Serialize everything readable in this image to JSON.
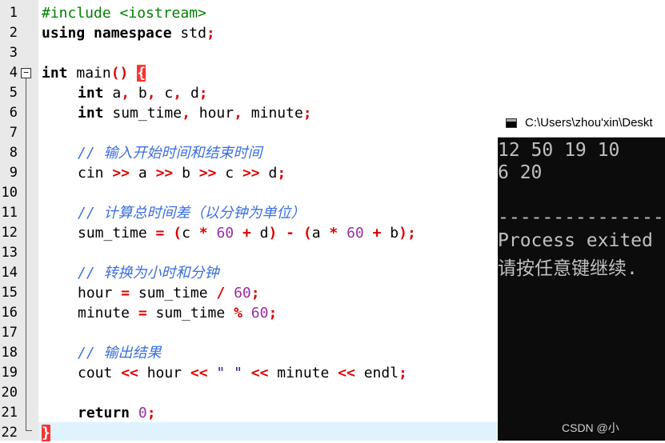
{
  "editor": {
    "line_numbers": [
      "1",
      "2",
      "3",
      "4",
      "5",
      "6",
      "7",
      "8",
      "9",
      "10",
      "11",
      "12",
      "13",
      "14",
      "15",
      "16",
      "17",
      "18",
      "19",
      "20",
      "21",
      "22"
    ],
    "fold_marker": "−",
    "lines": {
      "l1_pre": "#include <iostream>",
      "l2_kw": "using namespace",
      "l2_txt": " std",
      "l2_semi": ";",
      "l4_kw": "int",
      "l4_txt": " main",
      "l4_paren": "()",
      "l4_brace": "{",
      "l5_kw": "int",
      "l5_a": " a",
      "l5_c1": ",",
      "l5_b": " b",
      "l5_c2": ",",
      "l5_c": " c",
      "l5_c3": ",",
      "l5_d": " d",
      "l5_semi": ";",
      "l6_kw": "int",
      "l6_sum": " sum_time",
      "l6_c1": ",",
      "l6_hour": " hour",
      "l6_c2": ",",
      "l6_min": " minute",
      "l6_semi": ";",
      "l8_cmt": "// 输入开始时间和结束时间",
      "l9_cin": "cin ",
      "l9_op1": ">>",
      "l9_a": " a ",
      "l9_op2": ">>",
      "l9_b": " b ",
      "l9_op3": ">>",
      "l9_c": " c ",
      "l9_op4": ">>",
      "l9_d": " d",
      "l9_semi": ";",
      "l11_cmt": "// 计算总时间差（以分钟为单位）",
      "l12_sum": "sum_time ",
      "l12_eq": "=",
      "l12_p1": " (",
      "l12_c": "c ",
      "l12_mul1": "*",
      "l12_n1": " 60",
      "l12_plus1": " +",
      "l12_d": " d",
      "l12_p2": ")",
      "l12_minus": " -",
      "l12_p3": " (",
      "l12_a": "a ",
      "l12_mul2": "*",
      "l12_n2": " 60",
      "l12_plus2": " +",
      "l12_b": " b",
      "l12_p4": ")",
      "l12_semi": ";",
      "l14_cmt": "// 转换为小时和分钟",
      "l15_hour": "hour ",
      "l15_eq": "=",
      "l15_sum": " sum_time ",
      "l15_div": "/",
      "l15_n": " 60",
      "l15_semi": ";",
      "l16_min": "minute ",
      "l16_eq": "=",
      "l16_sum": " sum_time ",
      "l16_mod": "%",
      "l16_n": " 60",
      "l16_semi": ";",
      "l18_cmt": "// 输出结果",
      "l19_cout": "cout ",
      "l19_op1": "<<",
      "l19_hour": " hour ",
      "l19_op2": "<<",
      "l19_str": " \" \" ",
      "l19_op3": "<<",
      "l19_min": " minute ",
      "l19_op4": "<<",
      "l19_endl": " endl",
      "l19_semi": ";",
      "l21_kw": "return",
      "l21_n": " 0",
      "l21_semi": ";",
      "l22_brace": "}"
    }
  },
  "console": {
    "title": "C:\\Users\\zhou'xin\\Deskt",
    "output": [
      "12 50 19 10",
      "6 20",
      "",
      "-----------------",
      "Process exited",
      "请按任意键继续."
    ],
    "watermark": "CSDN @小"
  },
  "colors": {
    "keyword": "#000000",
    "operator": "#e00000",
    "number": "#9b2ea6",
    "comment": "#3b6fe0",
    "preprocessor": "#008000",
    "gutter": "#e9e9e9",
    "console_bg": "#0c0c0c"
  }
}
